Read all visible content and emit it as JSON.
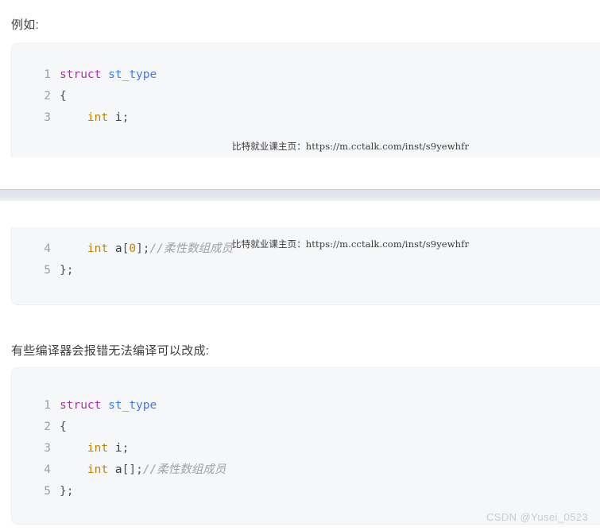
{
  "article": {
    "intro_text": "例如:",
    "mid_text": "有些编译器会报错无法编译可以改成:"
  },
  "code_blocks": [
    {
      "id": "block-1",
      "lines": [
        {
          "number": "1",
          "tokens": [
            {
              "text": "struct",
              "type": "keyword"
            },
            {
              "text": " ",
              "type": "plain"
            },
            {
              "text": "st_type",
              "type": "type"
            }
          ]
        },
        {
          "number": "2",
          "tokens": [
            {
              "text": "{",
              "type": "punct"
            }
          ]
        },
        {
          "number": "3",
          "tokens": [
            {
              "text": "    ",
              "type": "plain"
            },
            {
              "text": "int",
              "type": "number"
            },
            {
              "text": " ",
              "type": "plain"
            },
            {
              "text": "i",
              "type": "name"
            },
            {
              "text": ";",
              "type": "punct"
            }
          ]
        }
      ]
    },
    {
      "id": "block-2",
      "lines": [
        {
          "number": "4",
          "tokens": [
            {
              "text": "    ",
              "type": "plain"
            },
            {
              "text": "int",
              "type": "number"
            },
            {
              "text": " ",
              "type": "plain"
            },
            {
              "text": "a",
              "type": "name"
            },
            {
              "text": "[",
              "type": "punct"
            },
            {
              "text": "0",
              "type": "number"
            },
            {
              "text": "]",
              "type": "punct"
            },
            {
              "text": ";",
              "type": "punct"
            },
            {
              "text": "//柔性数组成员",
              "type": "comment"
            }
          ]
        },
        {
          "number": "5",
          "tokens": [
            {
              "text": "};",
              "type": "punct"
            }
          ]
        }
      ]
    },
    {
      "id": "block-3",
      "lines": [
        {
          "number": "1",
          "tokens": [
            {
              "text": "struct",
              "type": "keyword"
            },
            {
              "text": " ",
              "type": "plain"
            },
            {
              "text": "st_type",
              "type": "type"
            }
          ]
        },
        {
          "number": "2",
          "tokens": [
            {
              "text": "{",
              "type": "punct"
            }
          ]
        },
        {
          "number": "3",
          "tokens": [
            {
              "text": "    ",
              "type": "plain"
            },
            {
              "text": "int",
              "type": "number"
            },
            {
              "text": " ",
              "type": "plain"
            },
            {
              "text": "i",
              "type": "name"
            },
            {
              "text": ";",
              "type": "punct"
            }
          ]
        },
        {
          "number": "4",
          "tokens": [
            {
              "text": "    ",
              "type": "plain"
            },
            {
              "text": "int",
              "type": "number"
            },
            {
              "text": " ",
              "type": "plain"
            },
            {
              "text": "a",
              "type": "name"
            },
            {
              "text": "[",
              "type": "punct"
            },
            {
              "text": "]",
              "type": "punct"
            },
            {
              "text": ";",
              "type": "punct"
            },
            {
              "text": "//柔性数组成员",
              "type": "comment"
            }
          ]
        },
        {
          "number": "5",
          "tokens": [
            {
              "text": "};",
              "type": "punct"
            }
          ]
        }
      ]
    }
  ],
  "watermarks": {
    "course_url_1": "比特就业课主页：https://m.cctalk.com/inst/s9yewhfr",
    "course_url_2": "比特就业课主页：https://m.cctalk.com/inst/s9yewhfr",
    "csdn_author": "CSDN @Yusei_0523"
  },
  "colors": {
    "keyword": "#b32ab5",
    "type": "#4078f2",
    "number": "#c18401",
    "comment": "#a0a1a7",
    "code_bg": "#f6f7f9",
    "line_number": "#9aa0a6"
  }
}
